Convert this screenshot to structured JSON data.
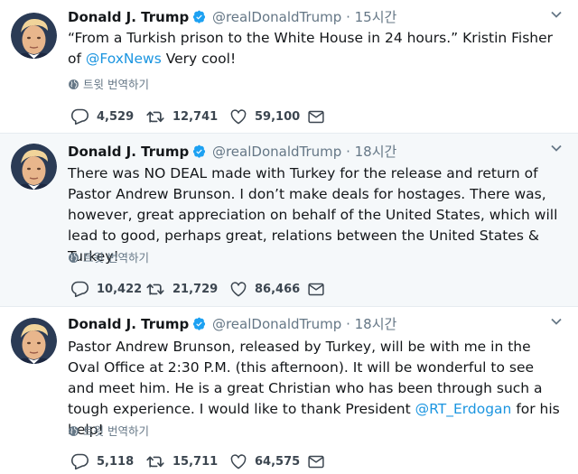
{
  "tweets": [
    {
      "name": "Donald J. Trump",
      "handle": "@realDonaldTrump",
      "dot": "·",
      "time": "15시간",
      "text_parts": [
        {
          "t": "“From a Turkish prison to the White House in 24 hours.”  Kristin Fisher of ",
          "link": false
        },
        {
          "t": "@FoxNews",
          "link": true
        },
        {
          "t": "  Very cool!",
          "link": false
        }
      ],
      "translate": "트윗 번역하기",
      "replies": "4,529",
      "retweets": "12,741",
      "likes": "59,100"
    },
    {
      "name": "Donald J. Trump",
      "handle": "@realDonaldTrump",
      "dot": "·",
      "time": "18시간",
      "text_parts": [
        {
          "t": "There was NO DEAL made with Turkey for the release and return of Pastor Andrew Brunson. I don’t make deals for hostages. There was, however, great appreciation on behalf of the United States, which will lead to good, perhaps great, relations between the United States & Turkey!",
          "link": false
        }
      ],
      "translate": "트윗 번역하기",
      "replies": "10,422",
      "retweets": "21,729",
      "likes": "86,466"
    },
    {
      "name": "Donald J. Trump",
      "handle": "@realDonaldTrump",
      "dot": "·",
      "time": "18시간",
      "text_parts": [
        {
          "t": "Pastor Andrew Brunson, released by Turkey, will be with me in the Oval Office at 2:30 P.M. (this afternoon). It will be wonderful to see and meet him. He is a great Christian who has been through such a tough experience. I would like to thank President ",
          "link": false
        },
        {
          "t": "@RT_Erdogan",
          "link": true
        },
        {
          "t": " for his help!",
          "link": false
        }
      ],
      "translate": "트윗 번역하기",
      "replies": "5,118",
      "retweets": "15,711",
      "likes": "64,575"
    }
  ],
  "colors": {
    "link": "#1b95e0",
    "verified": "#1da1f2",
    "muted": "#657786",
    "highlight_bg": "#f5f8fa"
  },
  "icons": [
    "verified-badge-icon",
    "caret-down-icon",
    "globe-icon",
    "reply-icon",
    "retweet-icon",
    "like-icon",
    "direct-message-icon"
  ]
}
